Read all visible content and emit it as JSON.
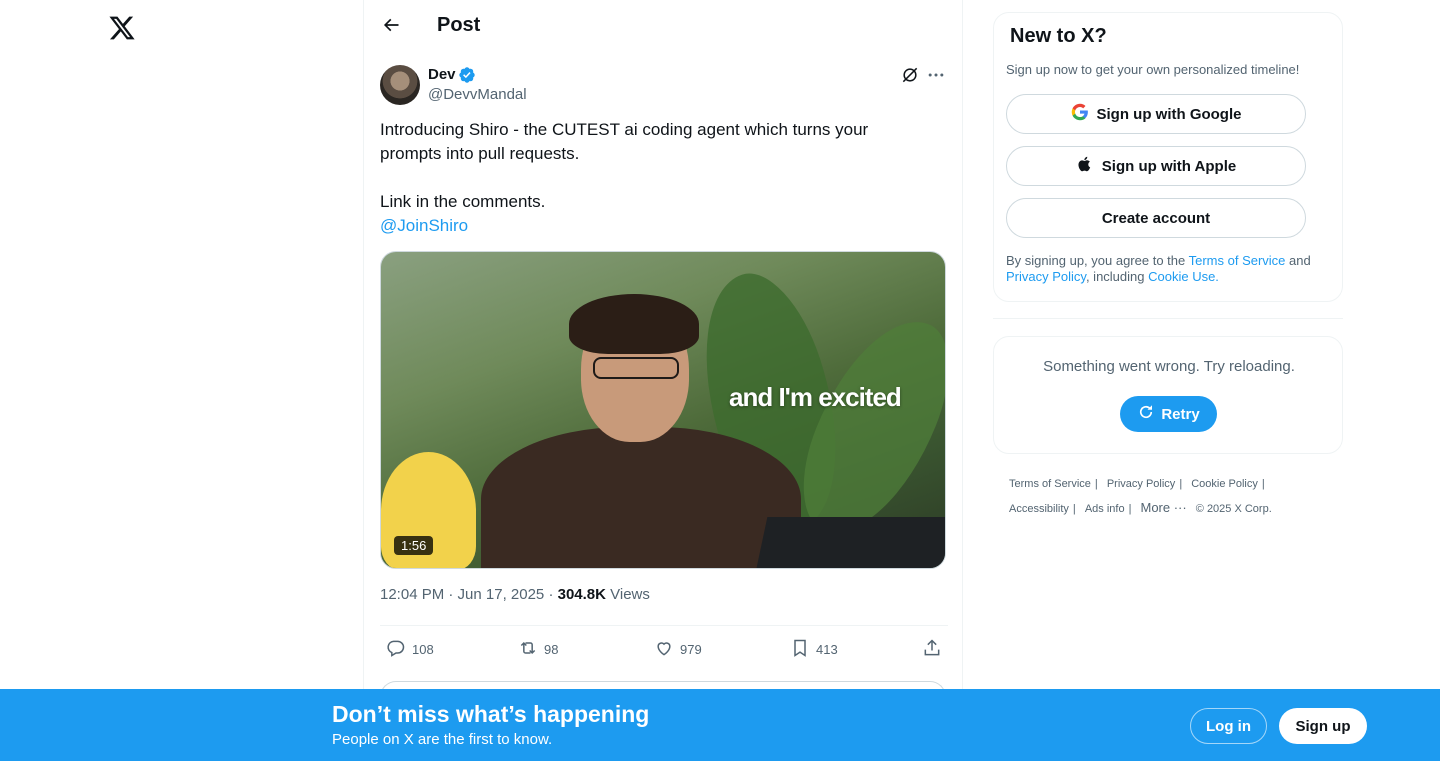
{
  "colors": {
    "accent": "#1d9bf0",
    "text": "#0f1419",
    "muted": "#536471",
    "border": "#eff3f4"
  },
  "nav": {
    "logo_icon": "x-logo-icon"
  },
  "header": {
    "back_icon": "arrow-left-icon",
    "title": "Post"
  },
  "post": {
    "author": {
      "name": "Dev",
      "handle": "@DevvMandal",
      "verified": true
    },
    "text_lines": [
      "Introducing Shiro - the CUTEST ai coding agent which turns your",
      "prompts into pull requests.",
      "",
      "Link in the comments."
    ],
    "mention": "@JoinShiro",
    "media": {
      "caption": "and I'm excited",
      "duration": "1:56"
    },
    "timestamp": "12:04 PM · Jun 17, 2025 · ",
    "views_count": "304.8K",
    "views_label": " Views",
    "stats": {
      "replies": "108",
      "reposts": "98",
      "likes": "979",
      "bookmarks": "413"
    }
  },
  "sidebar": {
    "signup_card": {
      "title": "New to X?",
      "subtitle": "Sign up now to get your own personalized timeline!",
      "google_label": "Sign up with Google",
      "apple_label": "Sign up with Apple",
      "create_label": "Create account",
      "legal_prefix": "By signing up, you agree to the ",
      "terms": "Terms of Service",
      "and": " and",
      "privacy": "Privacy Policy",
      "including": ", including ",
      "cookie": "Cookie Use."
    },
    "error_card": {
      "message": "Something went wrong. Try reloading.",
      "retry_label": "Retry"
    },
    "footer": {
      "terms": "Terms of Service",
      "privacy": "Privacy Policy",
      "cookie": "Cookie Policy",
      "accessibility": "Accessibility",
      "ads": "Ads info",
      "more": "More ···",
      "copyright": "© 2025 X Corp."
    }
  },
  "banner": {
    "title": "Don’t miss what’s happening",
    "subtitle": "People on X are the first to know.",
    "login_label": "Log in",
    "signup_label": "Sign up"
  }
}
